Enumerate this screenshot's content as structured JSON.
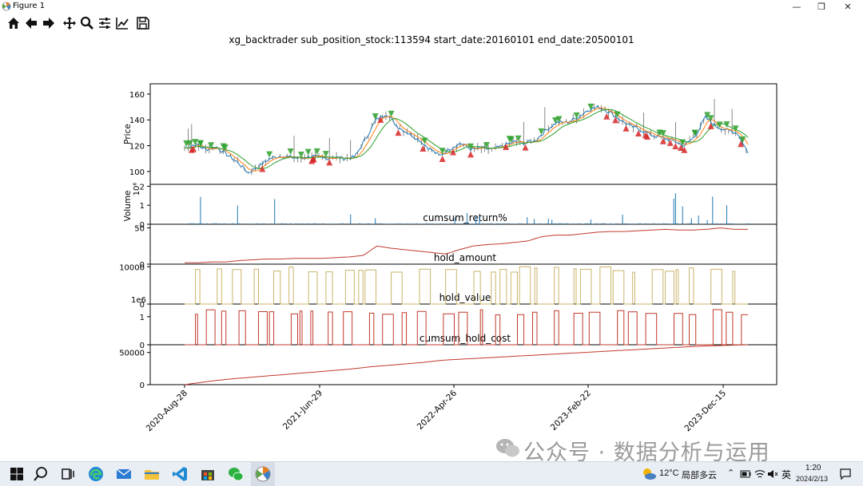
{
  "window": {
    "title": "Figure 1",
    "minimize": "—",
    "restore": "❐",
    "close": "✕"
  },
  "toolbar": {
    "buttons": [
      "home-icon",
      "back-icon",
      "forward-icon",
      "pan-icon",
      "zoom-icon",
      "configure-subplots-icon",
      "edit-axis-icon",
      "save-icon"
    ]
  },
  "figure": {
    "suptitle": "xg_backtrader sub_position_stock:113594 start_date:20160101 end_date:20500101",
    "panels": [
      {
        "id": "price",
        "ylabel": "Price",
        "ticks": [
          "160",
          "140",
          "120",
          "100"
        ],
        "title": ""
      },
      {
        "id": "volume",
        "ylabel": "Volume",
        "offset": "10⁶",
        "ticks": [
          "2",
          "1",
          "0"
        ],
        "title": ""
      },
      {
        "id": "cumsum_return",
        "ylabel": "",
        "ticks": [
          "50",
          "0"
        ],
        "title": "cumsum_return%"
      },
      {
        "id": "hold_amount",
        "ylabel": "",
        "ticks": [
          "10000",
          "0"
        ],
        "title": "hold_amount"
      },
      {
        "id": "hold_value",
        "ylabel": "",
        "offset": "1e6",
        "ticks": [
          "1",
          "0"
        ],
        "title": "hold_value"
      },
      {
        "id": "cumsum_hold_cost",
        "ylabel": "",
        "ticks": [
          "50000",
          "0"
        ],
        "title": "cumsum_hold_cost"
      }
    ],
    "xticks": [
      "2020-Aug-28",
      "2021-Jun-29",
      "2022-Apr-26",
      "2023-Feb-22",
      "2023-Dec-15"
    ]
  },
  "chart_data": {
    "type": "line",
    "x_dates": [
      "2020-Aug-28",
      "2021-Jun-29",
      "2022-Apr-26",
      "2023-Feb-22",
      "2023-Dec-15"
    ],
    "price": {
      "ylim": [
        90,
        168
      ],
      "close": [
        118,
        121,
        117,
        119,
        113,
        107,
        99,
        104,
        110,
        112,
        111,
        110,
        112,
        110,
        111,
        110,
        111,
        125,
        140,
        145,
        135,
        130,
        125,
        118,
        112,
        118,
        122,
        117,
        118,
        117,
        120,
        123,
        122,
        124,
        132,
        138,
        138,
        142,
        148,
        150,
        146,
        140,
        135,
        132,
        128,
        126,
        124,
        120,
        127,
        142,
        135,
        132,
        130,
        115
      ],
      "buy_markers": 28,
      "sell_markers": 40,
      "colors": {
        "close": "#1f77b4",
        "ma_fast": "#ff7f0e",
        "ma_slow": "#2ca02c",
        "buy": "#d62728",
        "sell": "#2ca02c"
      }
    },
    "volume": {
      "ylim": [
        0,
        2
      ],
      "unit": "10⁶",
      "color": "#1f77b4"
    },
    "cumsum_return": {
      "ylim": [
        0,
        55
      ],
      "color": "#c0392b",
      "values": [
        2,
        2,
        3,
        3,
        5,
        6,
        7,
        7,
        8,
        8,
        8,
        9,
        10,
        12,
        25,
        22,
        20,
        18,
        16,
        14,
        20,
        25,
        27,
        28,
        30,
        32,
        38,
        40,
        40,
        42,
        44,
        45,
        45,
        46,
        47,
        48,
        47,
        47,
        48,
        50,
        48,
        48
      ]
    },
    "hold_amount": {
      "ylim": [
        0,
        10000
      ],
      "color": "#c9b46a"
    },
    "hold_value": {
      "ylim": [
        0,
        1.4
      ],
      "unit": "1e6",
      "color": "#c0392b"
    },
    "cumsum_hold_cost": {
      "ylim": [
        0,
        60000
      ],
      "color": "#c0392b",
      "values": [
        0,
        5000,
        9000,
        12000,
        15000,
        18000,
        21000,
        24000,
        28000,
        31000,
        34000,
        38000,
        40000,
        42000,
        44000,
        46000,
        48000,
        50000,
        52000,
        54000,
        56000,
        58000,
        60000,
        61000,
        62000
      ]
    }
  },
  "watermark": "公众号 · 数据分析与运用",
  "taskbar": {
    "weather_temp": "12°C",
    "weather_desc": "局部多云",
    "ime": "英",
    "time": "1:20",
    "date": "2024/2/13"
  }
}
